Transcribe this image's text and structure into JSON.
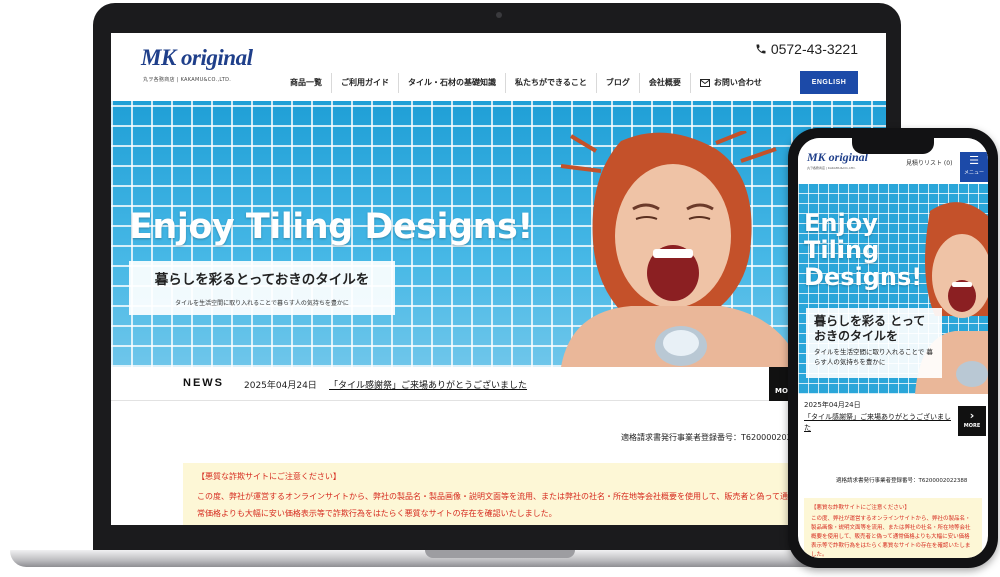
{
  "site": {
    "logo": "MK original",
    "logo_sub": "丸ヲ各務商店 | KAKAMU&CO.,LTD.",
    "phone": "0572-43-3221",
    "nav": [
      "商品一覧",
      "ご利用ガイド",
      "タイル・石材の基礎知識",
      "私たちができること",
      "ブログ",
      "会社概要",
      "お問い合わせ"
    ],
    "english_button": "ENGLISH"
  },
  "hero": {
    "title": "Enjoy Tiling Designs!",
    "heading": "暮らしを彩るとっておきのタイルを",
    "subheading": "タイルを生活空間に取り入れることで暮らす人の気持ちを豊かに"
  },
  "news": {
    "label": "NEWS",
    "date": "2025年04月24日",
    "link": "「タイル感謝祭」ご来場ありがとうございました",
    "more": "MORE"
  },
  "registration": "適格請求書発行事業者登録番号：T6200002022388",
  "notice": {
    "heading": "【悪質な詐欺サイトにご注意ください】",
    "lines": [
      "この度、弊社が運営するオンラインサイトから、弊社の製品名・製品画像・説明文面等を流用、または弊社の社名・所在地等会社概要を使用して、販売者と偽って通",
      "常価格よりも大幅に安い価格表示等で詐欺行為をはたらく悪質なサイトの存在を確認いたしました。"
    ]
  },
  "mobile": {
    "logo": "MK original",
    "logo_sub": "丸ヲ各務商店 | KAKAMU&CO.,LTD.",
    "cart": "見積りリスト (0)",
    "menu_label": "メニュー",
    "hero_title": "Enjoy Tiling Designs!",
    "hero_heading": "暮らしを彩る とっておきのタイルを",
    "hero_sub": "タイルを生活空間に取り入れることで 暮らす人の気持ちを豊かに",
    "news_date": "2025年04月24日",
    "news_link": "「タイル感謝祭」ご来場ありがとうございました",
    "more": "MORE",
    "registration": "適格請求書発行事業者登録番号：T6200002022388",
    "notice_heading": "【悪質な詐欺サイトにご注意ください】",
    "notice_body": "この度、弊社が運営するオンラインサイトから、弊社の製品名・製品画像・説明文面等を流用、または弊社の社名・所在地等会社概要を使用して、販売者と偽って通常価格よりも大幅に安い価格表示等で詐欺行為をはたらく悪質なサイトの存在を確認いたしました。"
  },
  "colors": {
    "brand_blue": "#1c4aa8",
    "tile_blue": "#2aa6d9",
    "notice_red": "#d62b1f",
    "notice_bg": "#fdf7d6"
  }
}
